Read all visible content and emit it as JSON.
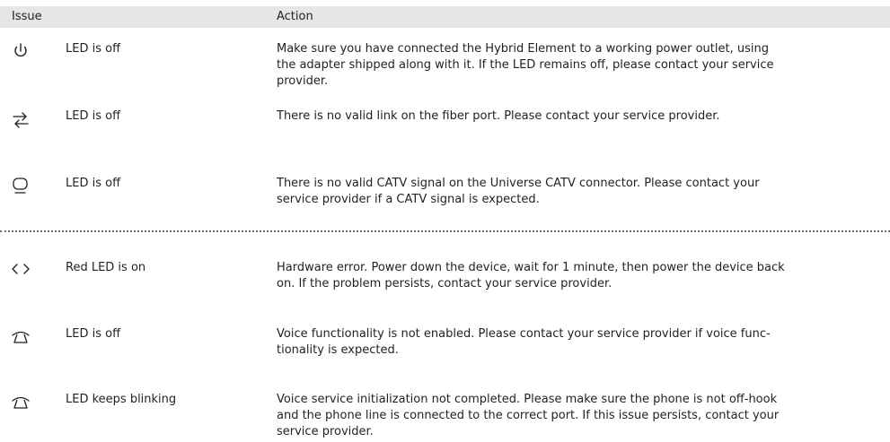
{
  "table": {
    "headers": {
      "issue": "Issue",
      "action": "Action"
    },
    "rows": [
      {
        "icon": "power-icon",
        "issue": "LED is off",
        "action_lines": [
          "Make sure you have connected the Hybrid Element to a working power outlet, using",
          "the adapter shipped along with it. If the LED remains off, please contact your service",
          "provider."
        ]
      },
      {
        "icon": "fiber-link-icon",
        "issue": "LED is off",
        "action_lines": [
          "There is no valid link on the fiber port. Please contact your service provider."
        ]
      },
      {
        "icon": "catv-icon",
        "issue": "LED is off",
        "action_lines": [
          "There is no valid CATV signal on the Universe CATV connector. Please contact your",
          "service provider if a CATV signal is expected."
        ]
      },
      {
        "icon": "hardware-error-icon",
        "issue": "Red LED is on",
        "action_lines": [
          "Hardware error. Power down the device, wait for 1 minute, then power the device back",
          "on. If the problem persists, contact your service provider."
        ]
      },
      {
        "icon": "phone-icon",
        "issue": "LED is off",
        "action_lines": [
          "Voice functionality is not enabled. Please contact your service provider if voice func-",
          "tionality is expected."
        ]
      },
      {
        "icon": "phone-icon",
        "issue": "LED keeps blinking",
        "action_lines": [
          "Voice service initialization not completed. Please make sure the phone is not off-hook",
          "and the phone line is connected to the correct port. If this issue persists, contact your",
          "service provider."
        ]
      }
    ]
  }
}
